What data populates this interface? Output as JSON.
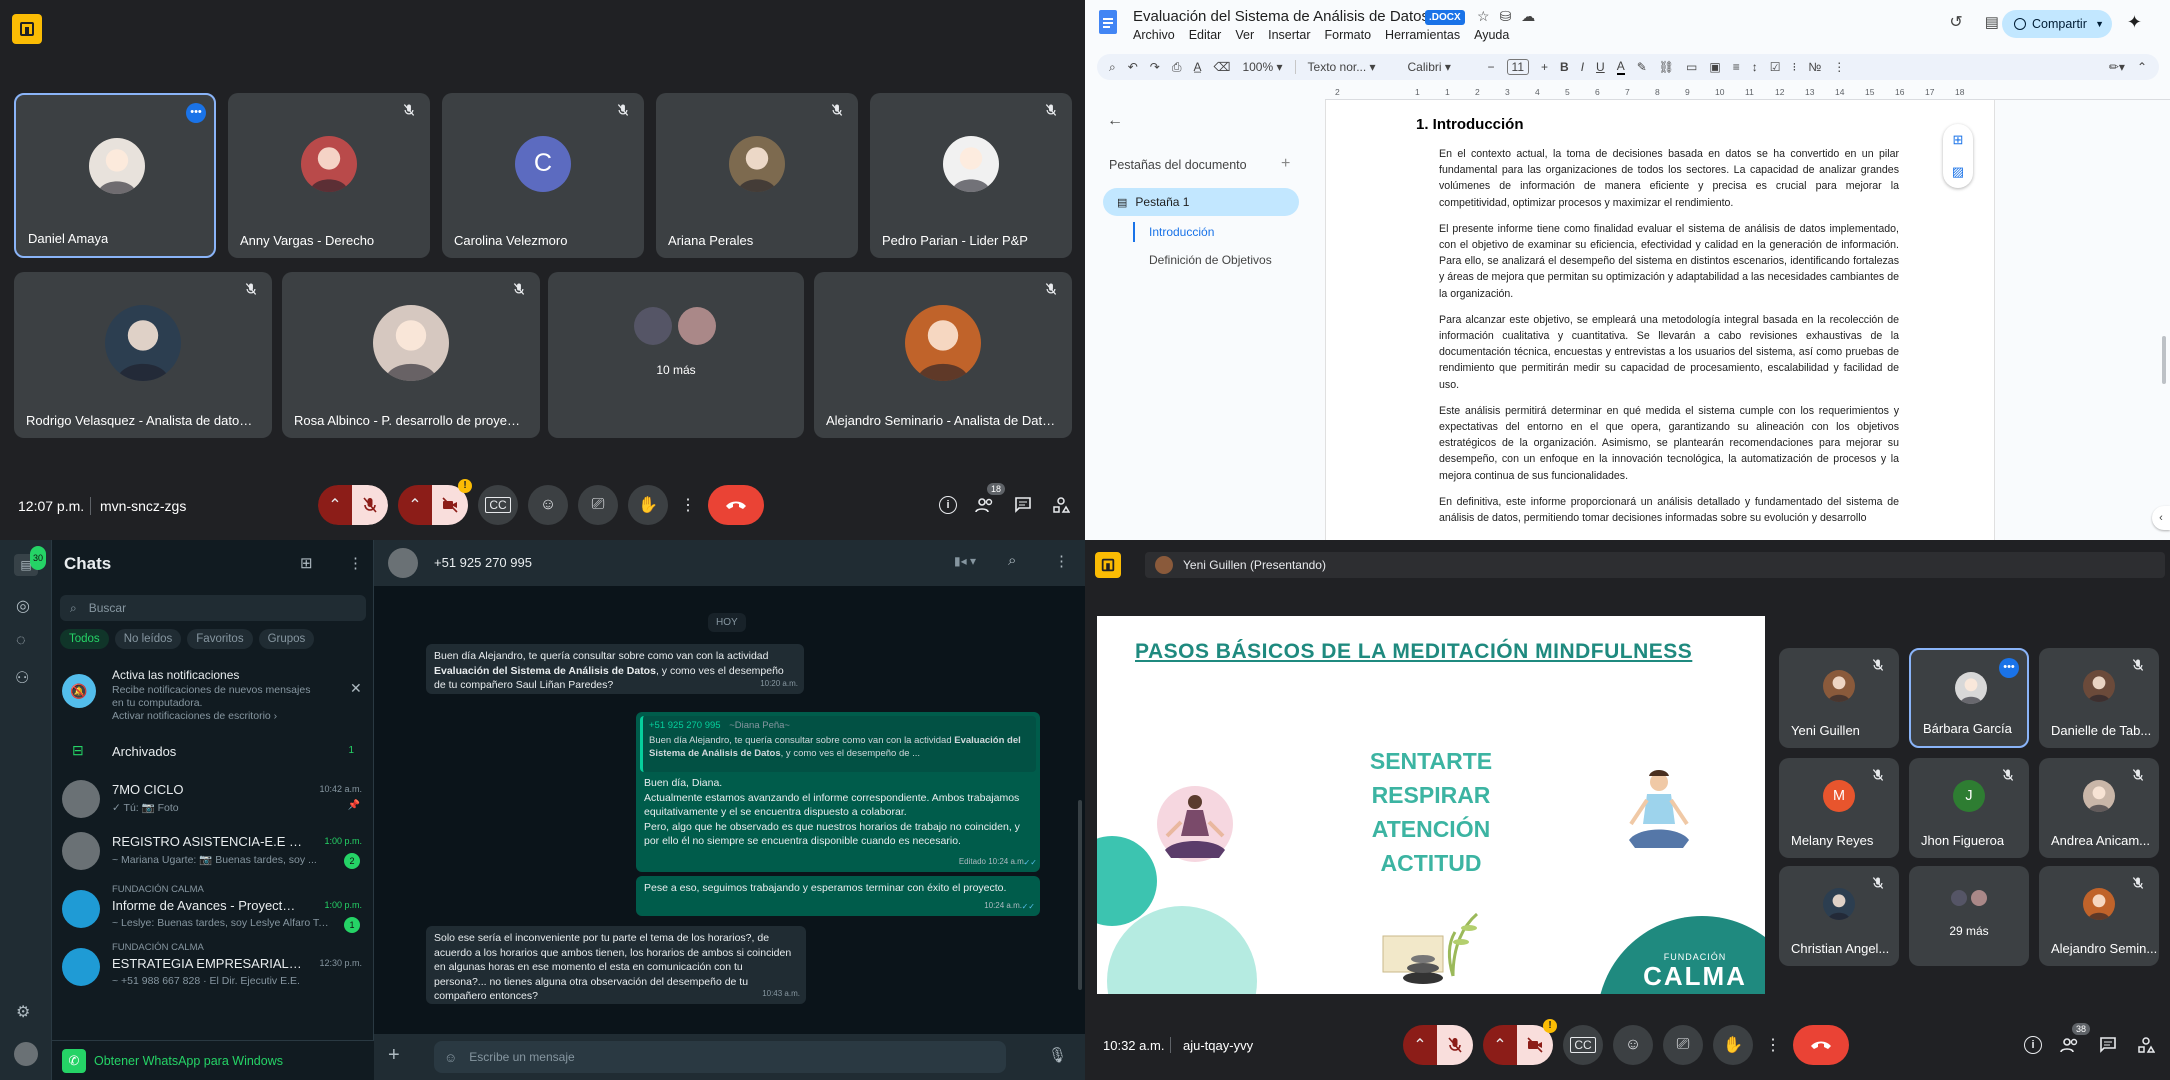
{
  "meet_top": {
    "time": "12:07 p.m.",
    "code": "mvn-sncz-zgs",
    "participants_count": "18",
    "participants": [
      {
        "name": "Daniel Amaya",
        "type": "photo",
        "color": "#e8e2dc"
      },
      {
        "name": "Anny Vargas - Derecho",
        "type": "photo",
        "color": "#b94a4a"
      },
      {
        "name": "Carolina Velezmoro",
        "type": "letter",
        "letter": "C",
        "color": "#5c6bc0"
      },
      {
        "name": "Ariana Perales",
        "type": "photo",
        "color": "#7d6a4f"
      },
      {
        "name": "Pedro Parian - Lider P&P",
        "type": "photo",
        "color": "#f1f1f1"
      },
      {
        "name": "Rodrigo Velasquez - Analista de datos Ge...",
        "type": "photo",
        "color": "#2c3e50"
      },
      {
        "name": "Rosa Albinco - P. desarrollo de proyectos",
        "type": "photo",
        "color": "#d6c8c0"
      },
      {
        "name": "10 más",
        "type": "more"
      },
      {
        "name": "Alejandro Seminario - Analista de Datos G...",
        "type": "photo",
        "color": "#c0632a"
      }
    ]
  },
  "docs": {
    "title": "Evaluación del Sistema de Análisis de Datos:",
    "badge": ".DOCX",
    "menu": [
      "Archivo",
      "Editar",
      "Ver",
      "Insertar",
      "Formato",
      "Herramientas",
      "Ayuda"
    ],
    "share_label": "Compartir",
    "zoom": "100%",
    "style": "Texto nor...",
    "font": "Calibri",
    "font_size": "11",
    "ruler_numbers": [
      "2",
      "1",
      "1",
      "2",
      "3",
      "4",
      "5",
      "6",
      "7",
      "8",
      "9",
      "10",
      "11",
      "12",
      "13",
      "14",
      "15",
      "16",
      "17",
      "18"
    ],
    "sidebar_title": "Pestañas del documento",
    "tab1": "Pestaña 1",
    "outline": [
      "Introducción",
      "Definición de Objetivos"
    ],
    "heading": "1.  Introducción",
    "paragraphs": [
      "En el contexto actual, la toma de decisiones basada en datos se ha convertido en un pilar fundamental para las organizaciones de todos los sectores. La capacidad de analizar grandes volúmenes de información de manera eficiente y precisa es crucial para mejorar la competitividad, optimizar procesos y maximizar el rendimiento.",
      "El presente informe tiene como finalidad evaluar el sistema de análisis de datos implementado, con el objetivo de examinar su eficiencia, efectividad y calidad en la generación de información. Para ello, se analizará el desempeño del sistema en distintos escenarios, identificando fortalezas y áreas de mejora que permitan su optimización y adaptabilidad a las necesidades cambiantes de la organización.",
      "Para alcanzar este objetivo, se empleará una metodología integral basada en la recolección de información cualitativa y cuantitativa. Se llevarán a cabo revisiones exhaustivas de la documentación técnica, encuestas y entrevistas a los usuarios del sistema, así como pruebas de rendimiento que permitirán medir su capacidad de procesamiento, escalabilidad y facilidad de uso.",
      "Este análisis permitirá determinar en qué medida el sistema cumple con los requerimientos y expectativas del entorno en el que opera, garantizando su alineación con los objetivos estratégicos de la organización. Asimismo, se plantearán recomendaciones para mejorar su desempeño, con un enfoque en la innovación tecnológica, la automatización de procesos y la mejora continua de sus funcionalidades.",
      "En definitiva, este informe proporcionará un análisis detallado y fundamentado del sistema de análisis de datos, permitiendo tomar decisiones informadas sobre su evolución y desarrollo"
    ]
  },
  "whatsapp": {
    "rail_badge": "30",
    "title": "Chats",
    "search_placeholder": "Buscar",
    "filters": [
      "Todos",
      "No leídos",
      "Favoritos",
      "Grupos"
    ],
    "notif_title": "Activa las notificaciones",
    "notif_body": "Recibe notificaciones de nuevos mensajes en tu computadora.",
    "notif_link": "Activar notificaciones de escritorio",
    "archived": "Archivados",
    "archived_count": "1",
    "chats": [
      {
        "prefix": "",
        "name": "7MO CICLO",
        "time": "10:42 a.m.",
        "preview": "✓ Tú: 📷 Foto",
        "badge": "",
        "pin": true
      },
      {
        "prefix": "",
        "name": "REGISTRO ASISTENCIA-E.E ✍️...",
        "time": "1:00 p.m.",
        "preview": "~ Mariana Ugarte: 📷 Buenas tardes, soy ...",
        "badge": "2",
        "pin": false
      },
      {
        "prefix": "FUNDACIÓN CALMA",
        "name": "Informe de Avances - Proyecto Te...",
        "time": "1:00 p.m.",
        "preview": "~ Leslye: Buenas tardes, soy Leslye Alfaro Tova...",
        "badge": "1",
        "pin": false
      },
      {
        "prefix": "FUNDACIÓN CALMA",
        "name": "ESTRATEGIA EMPRESARIAL-Fundación...",
        "time": "12:30 p.m.",
        "preview": "~ +51 988 667 828 · El Dir. Ejecutiv E.E.",
        "badge": "",
        "pin": false
      }
    ],
    "get_app": "Obtener WhatsApp para Windows",
    "contact": "+51 925 270 995",
    "day": "HOY",
    "msgs": [
      {
        "side": "in",
        "text_a": "Buen día Alejandro, te quería consultar sobre como van con la actividad ",
        "bold": "Evaluación del Sistema de Análisis de Datos",
        "text_b": ", y como ves el desempeño de tu compañero Saul Liñan Paredes?",
        "time": "10:20 a.m."
      },
      {
        "side": "out",
        "quote_author": "+51 925 270 995",
        "quote_name": "~Diana Peña~",
        "quote_text": "Buen día Alejandro, te quería consultar sobre como van con la actividad",
        "quote_bold": "Evaluación del Sistema de Análisis de Datos",
        "quote_tail": ", y como ves el desempeño de ...",
        "text": "Buen día, Diana.\nActualmente estamos avanzando el informe correspondiente. Ambos trabajamos equitativamente y el se encuentra dispuesto a colaborar.\nPero, algo que he observado es que nuestros horarios de trabajo no coinciden, y por ello él no siempre se encuentra disponible cuando es necesario.",
        "time": "Editado  10:24 a.m."
      },
      {
        "side": "out",
        "text": "Pese a eso, seguimos trabajando y esperamos terminar con éxito el proyecto.",
        "time": "10:24 a.m."
      },
      {
        "side": "in",
        "text": "Solo ese sería el inconveniente por tu parte el tema de los horarios?, de acuerdo a los horarios que ambos tienen, los horarios de ambos si coinciden en algunas horas en ese momento el esta en comunicación con tu persona?... no tienes alguna otra observación del desempeño de tu compañero entonces?",
        "time": "10:43 a.m."
      }
    ],
    "input_placeholder": "Escribe un mensaje"
  },
  "meet_bottom": {
    "presenter": "Yeni Guillen (Presentando)",
    "time": "10:32 a.m.",
    "code": "aju-tqay-yvy",
    "participants_count": "38",
    "slide": {
      "title": "PASOS BÁSICOS DE LA MEDITACIÓN MINDFULNESS",
      "steps": [
        "SENTARTE",
        "RESPIRAR",
        "ATENCIÓN",
        "ACTITUD"
      ],
      "logo_small": "FUNDACIÓN",
      "logo_big": "CALMA"
    },
    "people": [
      {
        "name": "Yeni Guillen",
        "type": "photo",
        "color": "#8a5a3b"
      },
      {
        "name": "Bárbara García",
        "type": "photo",
        "color": "#d8d8d8"
      },
      {
        "name": "Danielle de Tab...",
        "type": "photo",
        "color": "#6b4a3a"
      },
      {
        "name": "Melany Reyes",
        "type": "letter",
        "letter": "M",
        "color": "#e8552d"
      },
      {
        "name": "Jhon Figueroa",
        "type": "letter",
        "letter": "J",
        "color": "#2e7d32"
      },
      {
        "name": "Andrea Anicam...",
        "type": "photo",
        "color": "#c9b6a8"
      },
      {
        "name": "Christian Angel...",
        "type": "photo",
        "color": "#2c3e50"
      },
      {
        "name": "29 más",
        "type": "more"
      },
      {
        "name": "Alejandro Semin...",
        "type": "photo",
        "color": "#c0632a"
      }
    ]
  }
}
